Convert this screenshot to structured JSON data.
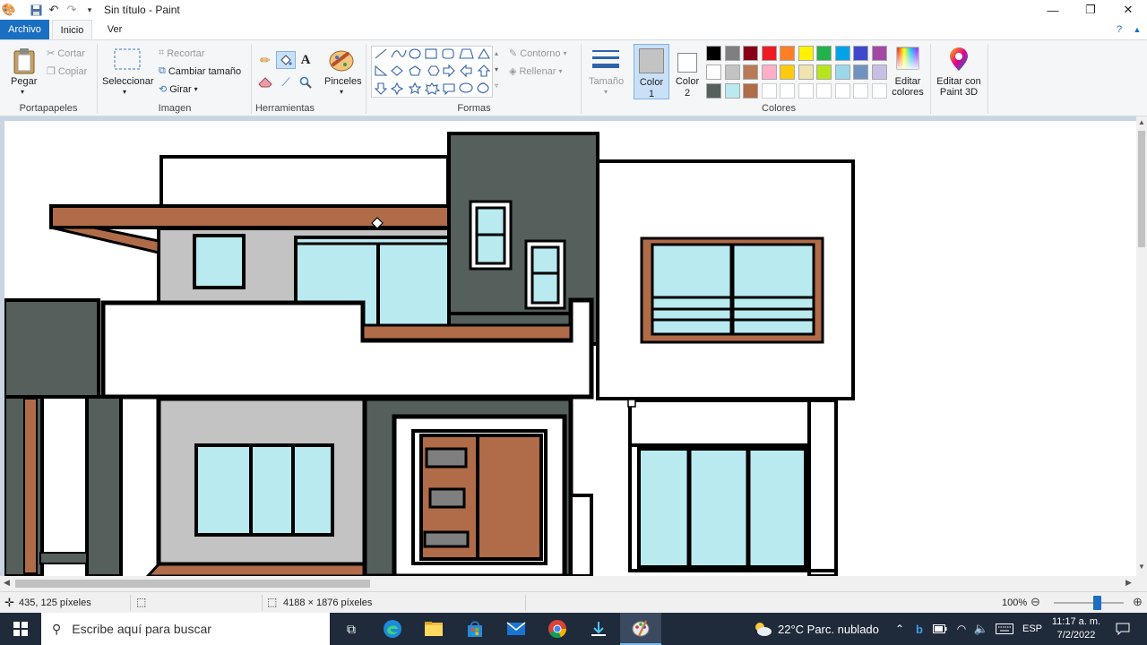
{
  "window": {
    "title": "Sin título - Paint",
    "minimize": "—",
    "restore": "❐",
    "close": "✕"
  },
  "tabs": {
    "archivo": "Archivo",
    "inicio": "Inicio",
    "ver": "Ver",
    "help": "?"
  },
  "ribbon": {
    "portapapeles": {
      "label": "Portapapeles",
      "pegar": "Pegar",
      "cortar": "Cortar",
      "copiar": "Copiar"
    },
    "imagen": {
      "label": "Imagen",
      "seleccionar": "Seleccionar",
      "recortar": "Recortar",
      "cambiar_tamano": "Cambiar tamaño",
      "girar": "Girar"
    },
    "herramientas": {
      "label": "Herramientas",
      "pinceles": "Pinceles"
    },
    "formas": {
      "label": "Formas",
      "contorno": "Contorno",
      "rellenar": "Rellenar"
    },
    "tamano": "Tamaño",
    "color1": "Color 1",
    "color2": "Color 2",
    "colores": {
      "label": "Colores",
      "editar": "Editar colores",
      "paint3d": "Editar con Paint 3D"
    }
  },
  "palette": {
    "row1": [
      "#000000",
      "#7f7f7f",
      "#880015",
      "#ed1c24",
      "#ff7f27",
      "#fff200",
      "#22b14c",
      "#00a2e8",
      "#3f48cc",
      "#a349a4"
    ],
    "row2": [
      "#ffffff",
      "#c3c3c3",
      "#b97a57",
      "#ffaec9",
      "#ffc90e",
      "#efe4b0",
      "#b5e61d",
      "#99d9ea",
      "#7092be",
      "#c8bfe7"
    ],
    "row3": [
      "#555f5c",
      "#b9eaf0",
      "#b06b48",
      "#ffffff",
      "#ffffff",
      "#ffffff",
      "#ffffff",
      "#ffffff",
      "#ffffff",
      "#ffffff"
    ],
    "color1": "#c3c3c3",
    "color2": "#ffffff"
  },
  "colors": {
    "wall_dark": "#555f5c",
    "wood": "#b06b48",
    "glass": "#b9eaf0",
    "grey_wall": "#c3c3c3",
    "accent": "#1a6fc2"
  },
  "status": {
    "cursor": "435, 125 píxeles",
    "size": "4188 × 1876 píxeles",
    "zoom": "100%",
    "zoom_level": 0.62
  },
  "taskbar": {
    "search_placeholder": "Escribe aquí para buscar",
    "weather": "22°C  Parc. nublado",
    "lang": "ESP",
    "time": "11:17 a. m.",
    "date": "7/2/2022"
  }
}
